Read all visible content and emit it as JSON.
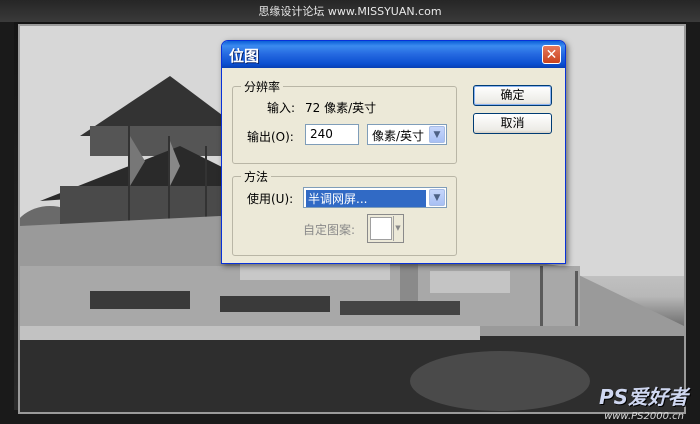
{
  "page": {
    "site_caption": "思缘设计论坛 www.MISSYUAN.com"
  },
  "dialog": {
    "title": "位图",
    "close_glyph": "✕",
    "resolution": {
      "group_label": "分辨率",
      "input_label": "输入:",
      "input_value": "72 像素/英寸",
      "output_label": "输出(O):",
      "output_value": "240",
      "unit_value": "像素/英寸"
    },
    "method": {
      "group_label": "方法",
      "use_label": "使用(U):",
      "use_value": "半调网屏...",
      "custom_pattern_label": "自定图案:"
    },
    "buttons": {
      "ok": "确定",
      "cancel": "取消"
    }
  },
  "watermark": {
    "brand": "PS爱好者",
    "url": "www.PS2000.cn"
  }
}
